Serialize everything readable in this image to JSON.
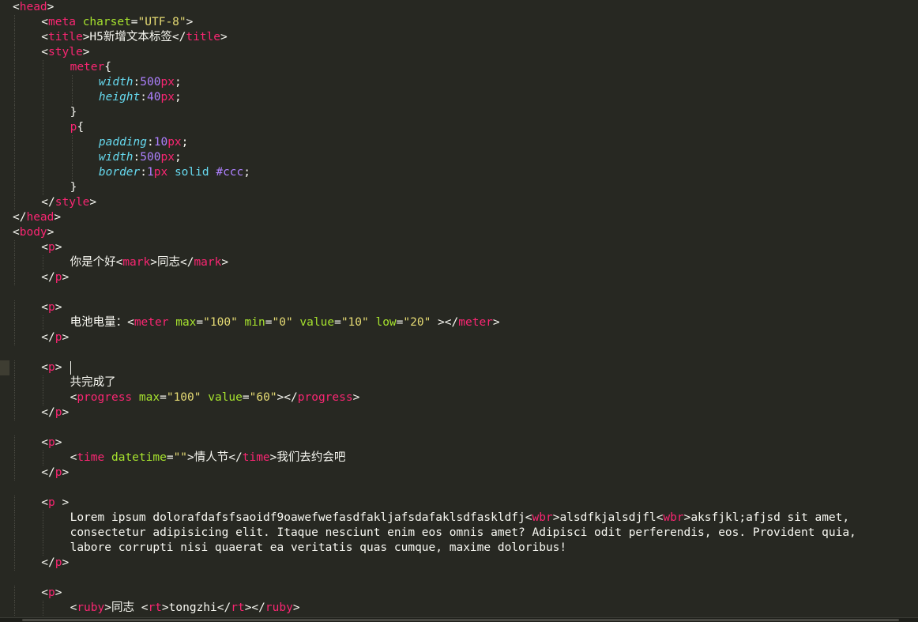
{
  "editor": {
    "theme": "monokai",
    "colors": {
      "background": "#272822",
      "tag": "#f92672",
      "attribute": "#a6e22e",
      "string": "#e6db74",
      "property": "#66d9ef",
      "number": "#ae81ff",
      "text": "#f8f8f2"
    },
    "cursor_line": 24,
    "lines": [
      {
        "indent": 0,
        "tokens": [
          [
            "punc",
            "<"
          ],
          [
            "tag",
            "head"
          ],
          [
            "punc",
            ">"
          ]
        ]
      },
      {
        "indent": 1,
        "tokens": [
          [
            "punc",
            "<"
          ],
          [
            "tag",
            "meta"
          ],
          [
            "punc",
            " "
          ],
          [
            "attr",
            "charset"
          ],
          [
            "punc",
            "="
          ],
          [
            "str",
            "\"UTF-8\""
          ],
          [
            "punc",
            ">"
          ]
        ]
      },
      {
        "indent": 1,
        "tokens": [
          [
            "punc",
            "<"
          ],
          [
            "tag",
            "title"
          ],
          [
            "punc",
            ">"
          ],
          [
            "text",
            "H5新增文本标签"
          ],
          [
            "punc",
            "</"
          ],
          [
            "tag",
            "title"
          ],
          [
            "punc",
            ">"
          ]
        ]
      },
      {
        "indent": 1,
        "tokens": [
          [
            "punc",
            "<"
          ],
          [
            "tag",
            "style"
          ],
          [
            "punc",
            ">"
          ]
        ]
      },
      {
        "indent": 2,
        "tokens": [
          [
            "tag",
            "meter"
          ],
          [
            "punc",
            "{"
          ]
        ]
      },
      {
        "indent": 3,
        "tokens": [
          [
            "prop",
            "width"
          ],
          [
            "punc",
            ":"
          ],
          [
            "num",
            "500"
          ],
          [
            "unit",
            "px"
          ],
          [
            "punc",
            ";"
          ]
        ]
      },
      {
        "indent": 3,
        "tokens": [
          [
            "prop",
            "height"
          ],
          [
            "punc",
            ":"
          ],
          [
            "num",
            "40"
          ],
          [
            "unit",
            "px"
          ],
          [
            "punc",
            ";"
          ]
        ]
      },
      {
        "indent": 2,
        "tokens": [
          [
            "punc",
            "}"
          ]
        ]
      },
      {
        "indent": 2,
        "tokens": [
          [
            "tag",
            "p"
          ],
          [
            "punc",
            "{"
          ]
        ]
      },
      {
        "indent": 3,
        "tokens": [
          [
            "prop",
            "padding"
          ],
          [
            "punc",
            ":"
          ],
          [
            "num",
            "10"
          ],
          [
            "unit",
            "px"
          ],
          [
            "punc",
            ";"
          ]
        ]
      },
      {
        "indent": 3,
        "tokens": [
          [
            "prop",
            "width"
          ],
          [
            "punc",
            ":"
          ],
          [
            "num",
            "500"
          ],
          [
            "unit",
            "px"
          ],
          [
            "punc",
            ";"
          ]
        ]
      },
      {
        "indent": 3,
        "tokens": [
          [
            "prop",
            "border"
          ],
          [
            "punc",
            ":"
          ],
          [
            "num",
            "1"
          ],
          [
            "unit",
            "px"
          ],
          [
            "punc",
            " "
          ],
          [
            "val",
            "solid"
          ],
          [
            "punc",
            " "
          ],
          [
            "num",
            "#ccc"
          ],
          [
            "punc",
            ";"
          ]
        ]
      },
      {
        "indent": 2,
        "tokens": [
          [
            "punc",
            "}"
          ]
        ]
      },
      {
        "indent": 1,
        "tokens": [
          [
            "punc",
            "</"
          ],
          [
            "tag",
            "style"
          ],
          [
            "punc",
            ">"
          ]
        ]
      },
      {
        "indent": 0,
        "tokens": [
          [
            "punc",
            "</"
          ],
          [
            "tag",
            "head"
          ],
          [
            "punc",
            ">"
          ]
        ]
      },
      {
        "indent": 0,
        "tokens": [
          [
            "punc",
            "<"
          ],
          [
            "tag",
            "body"
          ],
          [
            "punc",
            ">"
          ]
        ]
      },
      {
        "indent": 1,
        "tokens": [
          [
            "punc",
            "<"
          ],
          [
            "tag",
            "p"
          ],
          [
            "punc",
            ">"
          ]
        ]
      },
      {
        "indent": 2,
        "tokens": [
          [
            "text",
            "你是个好"
          ],
          [
            "punc",
            "<"
          ],
          [
            "tag",
            "mark"
          ],
          [
            "punc",
            ">"
          ],
          [
            "text",
            "同志"
          ],
          [
            "punc",
            "</"
          ],
          [
            "tag",
            "mark"
          ],
          [
            "punc",
            ">"
          ]
        ]
      },
      {
        "indent": 1,
        "tokens": [
          [
            "punc",
            "</"
          ],
          [
            "tag",
            "p"
          ],
          [
            "punc",
            ">"
          ]
        ]
      },
      {
        "indent": 0,
        "tokens": []
      },
      {
        "indent": 1,
        "tokens": [
          [
            "punc",
            "<"
          ],
          [
            "tag",
            "p"
          ],
          [
            "punc",
            ">"
          ]
        ]
      },
      {
        "indent": 2,
        "tokens": [
          [
            "text",
            "电池电量："
          ],
          [
            "punc",
            "<"
          ],
          [
            "tag",
            "meter"
          ],
          [
            "punc",
            " "
          ],
          [
            "attr",
            "max"
          ],
          [
            "punc",
            "="
          ],
          [
            "str",
            "\"100\""
          ],
          [
            "punc",
            " "
          ],
          [
            "attr",
            "min"
          ],
          [
            "punc",
            "="
          ],
          [
            "str",
            "\"0\""
          ],
          [
            "punc",
            " "
          ],
          [
            "attr",
            "value"
          ],
          [
            "punc",
            "="
          ],
          [
            "str",
            "\"10\""
          ],
          [
            "punc",
            " "
          ],
          [
            "attr",
            "low"
          ],
          [
            "punc",
            "="
          ],
          [
            "str",
            "\"20\""
          ],
          [
            "punc",
            " ></"
          ],
          [
            "tag",
            "meter"
          ],
          [
            "punc",
            ">"
          ]
        ]
      },
      {
        "indent": 1,
        "tokens": [
          [
            "punc",
            "</"
          ],
          [
            "tag",
            "p"
          ],
          [
            "punc",
            ">"
          ]
        ]
      },
      {
        "indent": 0,
        "tokens": []
      },
      {
        "indent": 1,
        "tokens": [
          [
            "punc",
            "<"
          ],
          [
            "tag",
            "p"
          ],
          [
            "punc",
            "> "
          ]
        ]
      },
      {
        "indent": 2,
        "tokens": [
          [
            "text",
            "共完成了"
          ]
        ]
      },
      {
        "indent": 2,
        "tokens": [
          [
            "punc",
            "<"
          ],
          [
            "tag",
            "progress"
          ],
          [
            "punc",
            " "
          ],
          [
            "attr",
            "max"
          ],
          [
            "punc",
            "="
          ],
          [
            "str",
            "\"100\""
          ],
          [
            "punc",
            " "
          ],
          [
            "attr",
            "value"
          ],
          [
            "punc",
            "="
          ],
          [
            "str",
            "\"60\""
          ],
          [
            "punc",
            "></"
          ],
          [
            "tag",
            "progress"
          ],
          [
            "punc",
            ">"
          ]
        ]
      },
      {
        "indent": 1,
        "tokens": [
          [
            "punc",
            "</"
          ],
          [
            "tag",
            "p"
          ],
          [
            "punc",
            ">"
          ]
        ]
      },
      {
        "indent": 0,
        "tokens": []
      },
      {
        "indent": 1,
        "tokens": [
          [
            "punc",
            "<"
          ],
          [
            "tag",
            "p"
          ],
          [
            "punc",
            ">"
          ]
        ]
      },
      {
        "indent": 2,
        "tokens": [
          [
            "punc",
            "<"
          ],
          [
            "tag",
            "time"
          ],
          [
            "punc",
            " "
          ],
          [
            "attr",
            "datetime"
          ],
          [
            "punc",
            "="
          ],
          [
            "str",
            "\"\""
          ],
          [
            "punc",
            ">"
          ],
          [
            "text",
            "情人节"
          ],
          [
            "punc",
            "</"
          ],
          [
            "tag",
            "time"
          ],
          [
            "punc",
            ">"
          ],
          [
            "text",
            "我们去约会吧"
          ]
        ]
      },
      {
        "indent": 1,
        "tokens": [
          [
            "punc",
            "</"
          ],
          [
            "tag",
            "p"
          ],
          [
            "punc",
            ">"
          ]
        ]
      },
      {
        "indent": 0,
        "tokens": []
      },
      {
        "indent": 1,
        "tokens": [
          [
            "punc",
            "<"
          ],
          [
            "tag",
            "p"
          ],
          [
            "punc",
            " >"
          ]
        ]
      },
      {
        "indent": 2,
        "tokens": [
          [
            "text",
            "Lorem ipsum dolorafdafsfsaoidf9oawefwefasdfakljafsdafaklsdfaskldfj"
          ],
          [
            "punc",
            "<"
          ],
          [
            "tag",
            "wbr"
          ],
          [
            "punc",
            ">"
          ],
          [
            "text",
            "alsdfkjalsdjfl"
          ],
          [
            "punc",
            "<"
          ],
          [
            "tag",
            "wbr"
          ],
          [
            "punc",
            ">"
          ],
          [
            "text",
            "aksfjkl;afjsd sit amet,"
          ]
        ]
      },
      {
        "indent": 2,
        "tokens": [
          [
            "text",
            "consectetur adipisicing elit. Itaque nesciunt enim eos omnis amet? Adipisci odit perferendis, eos. Provident quia,"
          ]
        ]
      },
      {
        "indent": 2,
        "tokens": [
          [
            "text",
            "labore corrupti nisi quaerat ea veritatis quas cumque, maxime doloribus!"
          ]
        ]
      },
      {
        "indent": 1,
        "tokens": [
          [
            "punc",
            "</"
          ],
          [
            "tag",
            "p"
          ],
          [
            "punc",
            ">"
          ]
        ]
      },
      {
        "indent": 0,
        "tokens": []
      },
      {
        "indent": 1,
        "tokens": [
          [
            "punc",
            "<"
          ],
          [
            "tag",
            "p"
          ],
          [
            "punc",
            ">"
          ]
        ]
      },
      {
        "indent": 2,
        "tokens": [
          [
            "punc",
            "<"
          ],
          [
            "tag",
            "ruby"
          ],
          [
            "punc",
            ">"
          ],
          [
            "text",
            "同志 "
          ],
          [
            "punc",
            "<"
          ],
          [
            "tag",
            "rt"
          ],
          [
            "punc",
            ">"
          ],
          [
            "text",
            "tongzhi"
          ],
          [
            "punc",
            "</"
          ],
          [
            "tag",
            "rt"
          ],
          [
            "punc",
            "></"
          ],
          [
            "tag",
            "ruby"
          ],
          [
            "punc",
            ">"
          ]
        ]
      }
    ]
  }
}
